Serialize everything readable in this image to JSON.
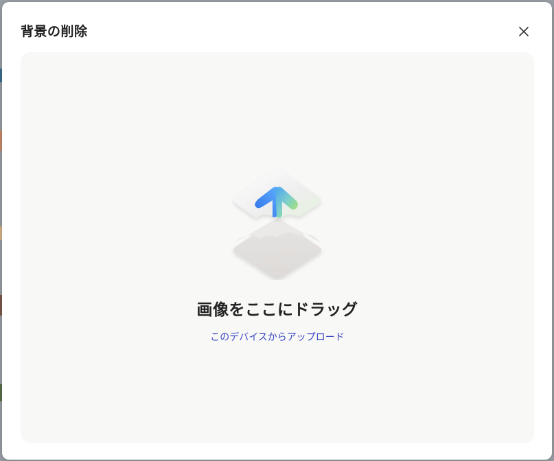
{
  "modal": {
    "title": "背景の削除",
    "close_label": "×"
  },
  "dropzone": {
    "title": "画像をここにドラッグ",
    "upload_link": "このデバイスからアップロード"
  },
  "icons": {
    "close": "close-icon",
    "upload": "upload-arrow-icon"
  },
  "colors": {
    "link": "#3b46c4",
    "arrow_blue": "#3a7ef0",
    "arrow_green": "#a8e063",
    "dropzone_bg": "#f8f8f7"
  }
}
